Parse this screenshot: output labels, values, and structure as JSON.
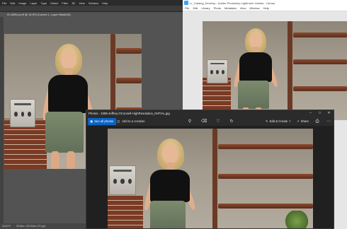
{
  "photoshop": {
    "menu": [
      "File",
      "Edit",
      "Image",
      "Layer",
      "Type",
      "Select",
      "Filter",
      "3D",
      "View",
      "Window",
      "Help"
    ],
    "doc_tab": "IS-1890-ps.tif @ 16.5% (Curves 1, Layer Mask/16)",
    "status": [
      "16.67%",
      "33.5cm x 50.02cm (72 ppi)"
    ]
  },
  "lightroom": {
    "title": "Lr_Catalog_Develop - Adobe Photoshop Lightroom Classic - Library",
    "menu": [
      "File",
      "Edit",
      "Library",
      "Photo",
      "Metadata",
      "View",
      "Window",
      "Help"
    ]
  },
  "photos": {
    "title": "Photos - 1089-Jeffrey-OConnell-HighResolution_INITIAL.jpg",
    "see_all_label": "See all photos",
    "add_label": "Add to a creation",
    "edit_label": "Edit & Create",
    "share_label": "Share",
    "icons": [
      "zoom-icon",
      "delete-icon",
      "favorite-icon",
      "rotate-icon",
      "print-icon",
      "more-icon"
    ]
  }
}
